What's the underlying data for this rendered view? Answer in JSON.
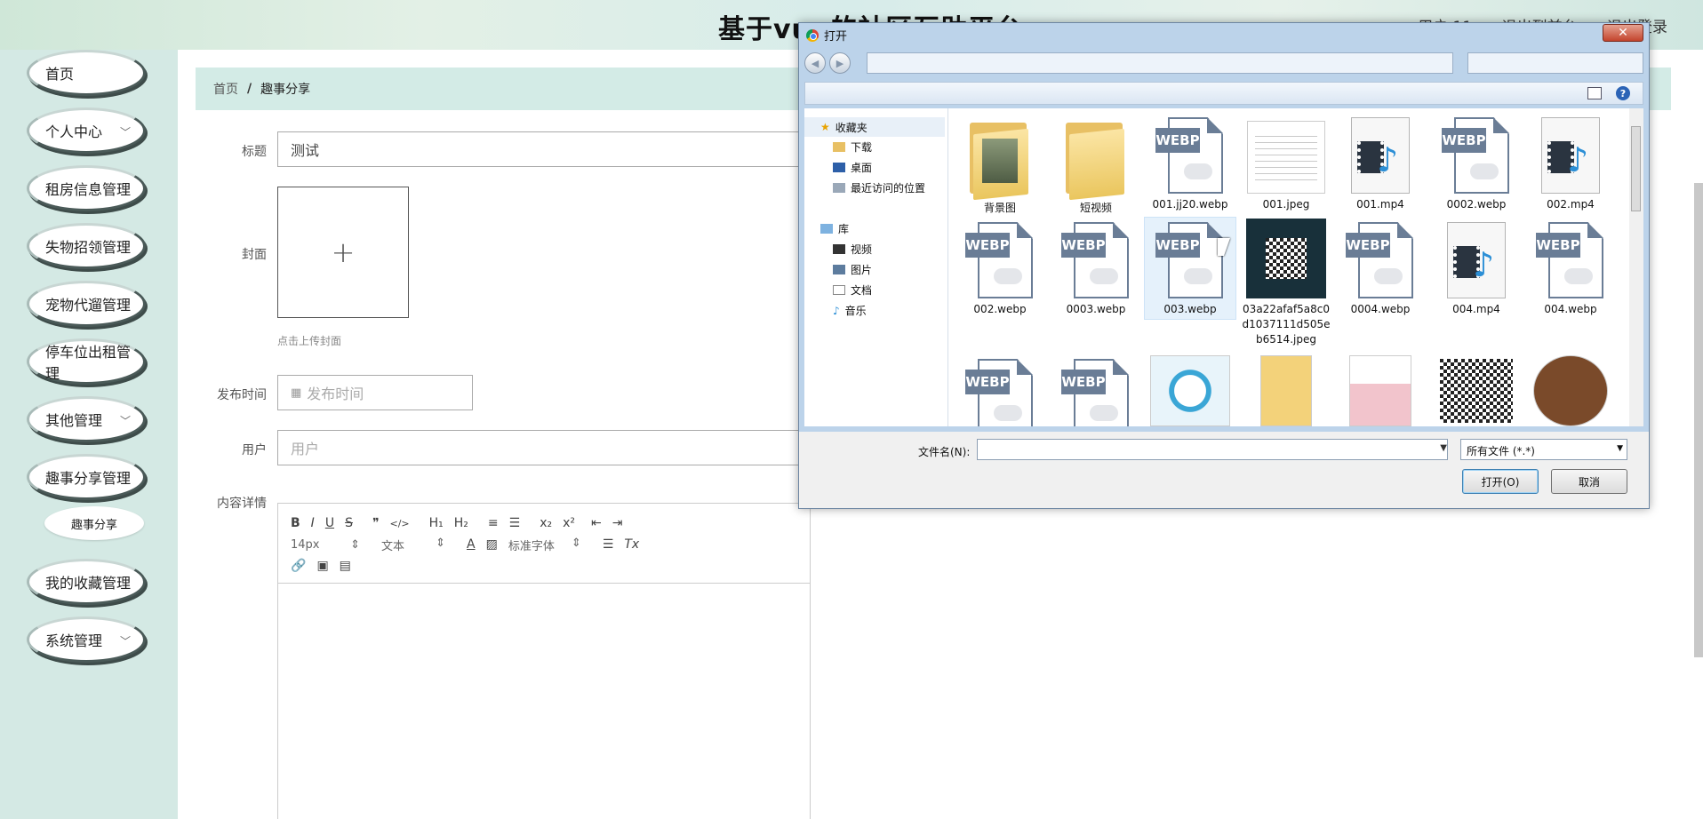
{
  "header": {
    "title": "基于vue的社区互助平台",
    "user_label": "用户 11",
    "back_label": "退出到前台",
    "logout_label": "退出登录"
  },
  "sidebar": {
    "items": [
      {
        "label": "首页",
        "has_chevron": false
      },
      {
        "label": "个人中心",
        "has_chevron": true
      },
      {
        "label": "租房信息管理",
        "has_chevron": false
      },
      {
        "label": "失物招领管理",
        "has_chevron": false
      },
      {
        "label": "宠物代遛管理",
        "has_chevron": false
      },
      {
        "label": "停车位出租管理",
        "has_chevron": false
      },
      {
        "label": "其他管理",
        "has_chevron": true
      },
      {
        "label": "趣事分享管理",
        "has_chevron": false
      },
      {
        "label": "我的收藏管理",
        "has_chevron": false
      },
      {
        "label": "系统管理",
        "has_chevron": true
      }
    ],
    "sub_item": "趣事分享"
  },
  "breadcrumb": {
    "home": "首页",
    "separator": "/",
    "current": "趣事分享"
  },
  "form": {
    "title_label": "标题",
    "title_value": "测试",
    "cover_label": "封面",
    "cover_hint": "点击上传封面",
    "time_label": "发布时间",
    "time_placeholder": "发布时间",
    "user_label": "用户",
    "user_placeholder": "用户",
    "content_label": "内容详情"
  },
  "editor": {
    "row1": [
      "B",
      "I",
      "U",
      "S",
      "❞",
      "</>",
      "H₁",
      "H₂",
      "≡",
      "☰",
      "x₂",
      "x²",
      "⇤",
      "⇥"
    ],
    "font_size": "14px",
    "text_style": "文本",
    "font_family": "标准字体",
    "clear": "Tx"
  },
  "dialog": {
    "title": "打开",
    "close": "✕",
    "nav": {
      "favorites": "收藏夹",
      "downloads": "下载",
      "desktop": "桌面",
      "recent": "最近访问的位置",
      "libraries": "库",
      "videos": "视频",
      "pictures": "图片",
      "documents": "文档",
      "music": "音乐"
    },
    "files": [
      {
        "name": "背景图",
        "kind": "folder"
      },
      {
        "name": "短视频",
        "kind": "folder"
      },
      {
        "name": "001.jj20.webp",
        "kind": "webp"
      },
      {
        "name": "001.jpeg",
        "kind": "jpeg"
      },
      {
        "name": "001.mp4",
        "kind": "mp4"
      },
      {
        "name": "0002.webp",
        "kind": "webp"
      },
      {
        "name": "002.mp4",
        "kind": "mp4"
      },
      {
        "name": "002.webp",
        "kind": "webp"
      },
      {
        "name": "0003.webp",
        "kind": "webp"
      },
      {
        "name": "003.webp",
        "kind": "webp",
        "selected": true
      },
      {
        "name": "03a22afaf5a8c0d1037111d505eb6514.jpeg",
        "kind": "qr"
      },
      {
        "name": "0004.webp",
        "kind": "webp"
      },
      {
        "name": "004.mp4",
        "kind": "mp4"
      },
      {
        "name": "004.webp",
        "kind": "webp"
      }
    ],
    "webp_badge": "WEBP",
    "filename_label": "文件名(N):",
    "filename_value": "",
    "filetype": "所有文件 (*.*)",
    "open_button": "打开(O)",
    "cancel_button": "取消",
    "help": "?"
  },
  "colors": {
    "sidebar_bg": "#d4e9e4",
    "breadcrumb_bg": "#d3ebe6",
    "dialog_frame": "#bcd3ea",
    "close_red": "#c3442d"
  }
}
